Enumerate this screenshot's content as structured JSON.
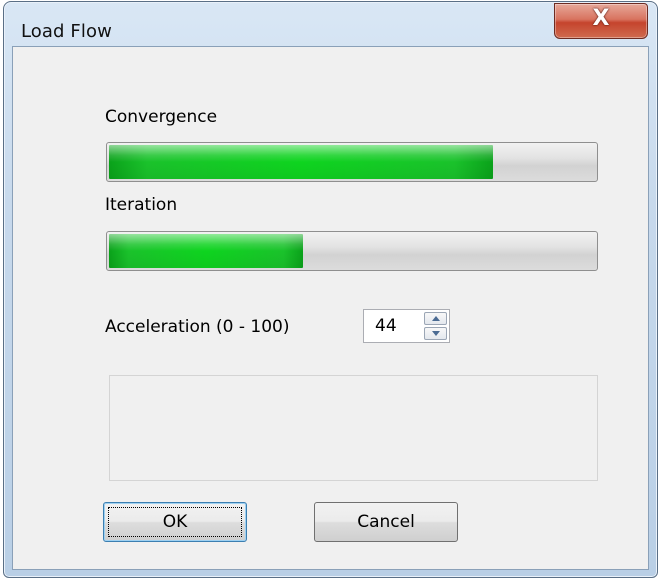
{
  "window": {
    "title": "Load Flow",
    "close_glyph": "X"
  },
  "convergence": {
    "label": "Convergence",
    "progress_fraction": 0.79
  },
  "iteration": {
    "label": "Iteration",
    "progress_fraction": 0.4
  },
  "acceleration": {
    "label": "Acceleration (0 - 100)",
    "value": "44"
  },
  "buttons": {
    "ok_label": "OK",
    "cancel_label": "Cancel"
  },
  "colors": {
    "progress_fill": "#0ed41f",
    "close_button": "#c5442d"
  },
  "icons": {
    "close": "close-icon",
    "spin_up": "chevron-up-icon",
    "spin_down": "chevron-down-icon"
  }
}
